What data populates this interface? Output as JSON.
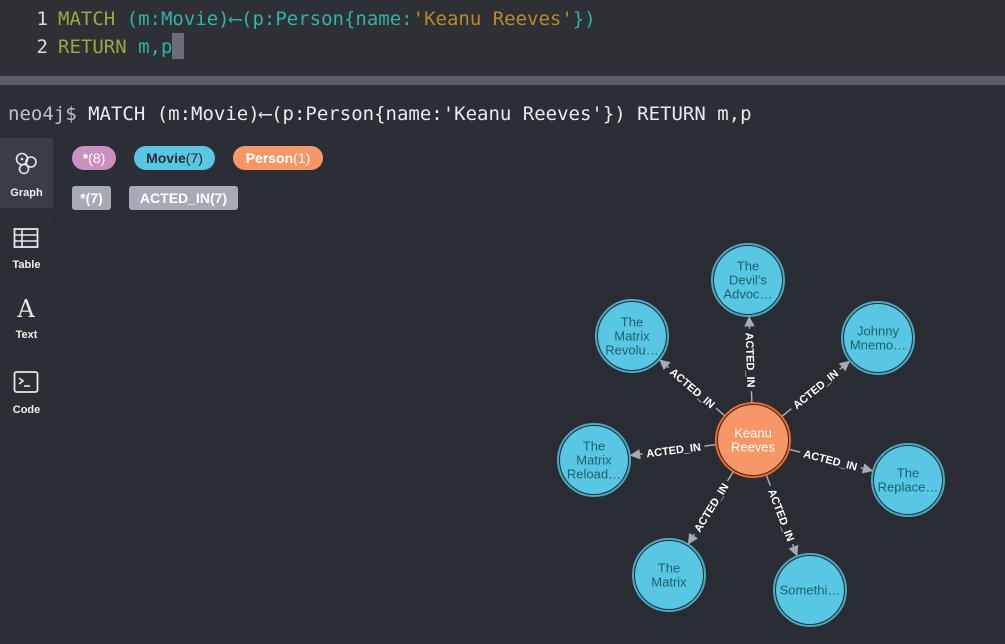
{
  "editor": {
    "lines": [
      {
        "number": "1",
        "segments": [
          {
            "text": "MATCH",
            "color": "#9aa93e"
          },
          {
            "text": " (m:Movie)⟵(p:Person{name:",
            "color": "#31b3a3"
          },
          {
            "text": "'Keanu Reeves'",
            "color": "#b98a2c"
          },
          {
            "text": "})",
            "color": "#31b3a3"
          }
        ]
      },
      {
        "number": "2",
        "segments": [
          {
            "text": "RETURN",
            "color": "#9aa93e"
          },
          {
            "text": " m,p",
            "color": "#31b3a3"
          }
        ]
      }
    ]
  },
  "command_bar": {
    "prompt": "neo4j$",
    "query": "MATCH (m:Movie)⟵(p:Person{name:'Keanu Reeves'}) RETURN m,p"
  },
  "sidebar": {
    "items": [
      {
        "label": "Graph",
        "icon": "graph-icon",
        "active": true
      },
      {
        "label": "Table",
        "icon": "table-icon",
        "active": false
      },
      {
        "label": "Text",
        "icon": "text-icon",
        "active": false
      },
      {
        "label": "Code",
        "icon": "code-icon",
        "active": false
      }
    ]
  },
  "legend": {
    "node_labels": [
      {
        "name": "*",
        "count": "(8)",
        "color": "#c990c0",
        "text_color": "#ffffff"
      },
      {
        "name": "Movie",
        "count": "(7)",
        "color": "#57c7e3",
        "text_color": "#2a2c34"
      },
      {
        "name": "Person",
        "count": "(1)",
        "color": "#f79767",
        "text_color": "#ffffff"
      }
    ],
    "relationship_types": [
      {
        "name": "*",
        "count": "(7)"
      },
      {
        "name": "ACTED_IN",
        "count": "(7)"
      }
    ]
  },
  "graph": {
    "center": {
      "lines": [
        "Keanu",
        "Reeves"
      ],
      "color": "#f79767",
      "stroke": "#f36924"
    },
    "relationship_label": "ACTED_IN",
    "movie_color": "#57c7e3",
    "movie_stroke": "#4ba9c3",
    "movies": [
      {
        "lines": [
          "The",
          "Devil's",
          "Advoc…"
        ]
      },
      {
        "lines": [
          "Johnny",
          "Mnemo…"
        ]
      },
      {
        "lines": [
          "The",
          "Replace…"
        ]
      },
      {
        "lines": [
          "Somethi…"
        ]
      },
      {
        "lines": [
          "The",
          "Matrix"
        ]
      },
      {
        "lines": [
          "The",
          "Matrix",
          "Reload…"
        ]
      },
      {
        "lines": [
          "The",
          "Matrix",
          "Revolu…"
        ]
      }
    ]
  }
}
